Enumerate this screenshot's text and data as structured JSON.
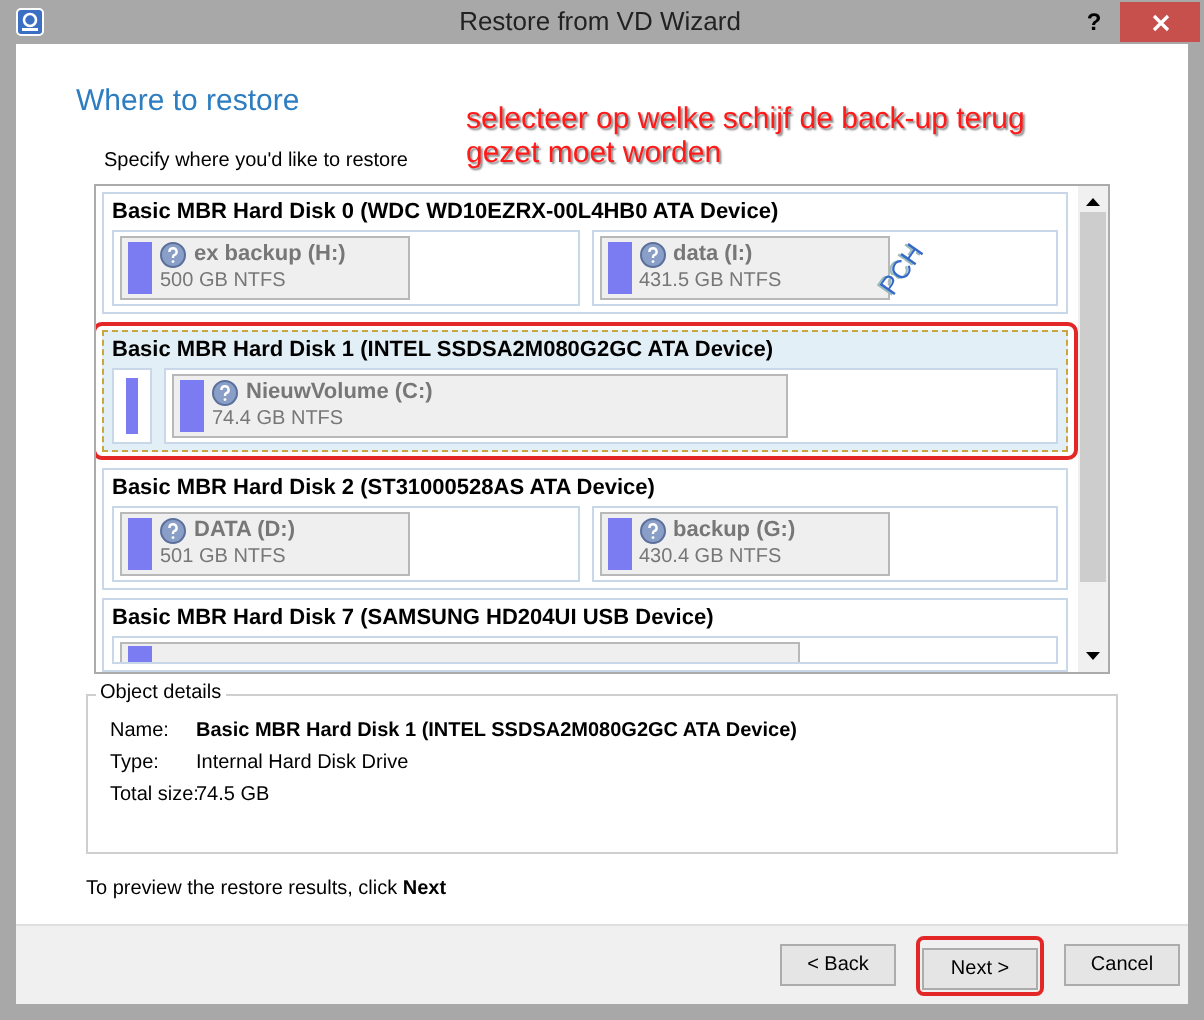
{
  "window": {
    "title": "Restore from VD Wizard",
    "help": "?"
  },
  "heading": "Where to restore",
  "annotation": "selecteer op welke schijf de back-up terug gezet moet worden",
  "instruction": "Specify where you'd like to restore",
  "disks": [
    {
      "name": "Basic MBR Hard Disk 0 (WDC WD10EZRX-00L4HB0 ATA Device)",
      "selected": false,
      "annotated": false,
      "partitions": [
        {
          "kind": "volume",
          "label": "ex backup (H:)",
          "size": "500 GB NTFS"
        },
        {
          "kind": "volume",
          "label": "data (I:)",
          "size": "431.5 GB NTFS",
          "stamp": "PCH"
        }
      ]
    },
    {
      "name": "Basic MBR Hard Disk 1 (INTEL SSDSA2M080G2GC ATA Device)",
      "selected": true,
      "annotated": true,
      "partitions": [
        {
          "kind": "small"
        },
        {
          "kind": "volume",
          "label": "NieuwVolume (C:)",
          "size": "74.4 GB NTFS"
        }
      ]
    },
    {
      "name": "Basic MBR Hard Disk 2 (ST31000528AS ATA Device)",
      "selected": false,
      "annotated": false,
      "partitions": [
        {
          "kind": "volume",
          "label": "DATA (D:)",
          "size": "501 GB NTFS"
        },
        {
          "kind": "volume",
          "label": "backup (G:)",
          "size": "430.4 GB NTFS"
        }
      ]
    },
    {
      "name": "Basic MBR Hard Disk 7 (SAMSUNG HD204UI USB Device)",
      "selected": false,
      "annotated": false,
      "partitions": [
        {
          "kind": "hidden"
        }
      ]
    }
  ],
  "details": {
    "title": "Object details",
    "fields": [
      {
        "label": "Name:",
        "value": "Basic MBR Hard Disk 1 (INTEL SSDSA2M080G2GC ATA Device)",
        "bold": true
      },
      {
        "label": "Type:",
        "value": "Internal Hard Disk Drive",
        "bold": false
      },
      {
        "label": "Total size:",
        "value": "74.5 GB",
        "bold": false
      }
    ]
  },
  "hint": "To preview the restore results, click **Next**",
  "buttons": [
    {
      "label": "< Back",
      "highlighted": false
    },
    {
      "label": "Next >",
      "highlighted": true
    },
    {
      "label": "Cancel",
      "highlighted": false
    }
  ]
}
